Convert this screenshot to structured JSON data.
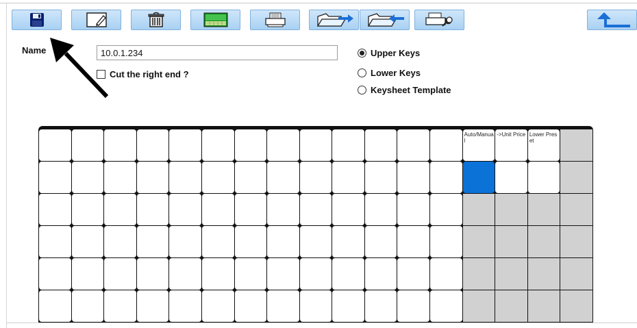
{
  "toolbar": {
    "buttons": [
      {
        "icon": "floppy-disk-icon"
      },
      {
        "icon": "edit-page-icon"
      },
      {
        "icon": "trash-bin-icon"
      },
      {
        "icon": "grid-layout-icon"
      },
      {
        "icon": "printer-icon"
      },
      {
        "icon": "export-folder-icon"
      },
      {
        "icon": "import-folder-icon"
      },
      {
        "icon": "device-settings-icon"
      },
      {
        "icon": "back-up-arrow-icon"
      }
    ]
  },
  "form": {
    "name_label": "Name",
    "name_value": "10.0.1.234",
    "cut_label": "Cut the right end ?",
    "cut_checked": false
  },
  "key_options": {
    "selected": "Upper Keys",
    "options": [
      "Upper Keys",
      "Lower Keys",
      "Keysheet Template"
    ]
  },
  "keyboard": {
    "columns": 17,
    "rows": 6,
    "labels": {
      "r0c13": "Auto/Manual",
      "r0c14": "->Unit Price",
      "r0c15": "Lower Preset"
    },
    "selected_key": "r1c13"
  },
  "colors": {
    "toolbar_bg": "#b8dbf6",
    "selected_key": "#0b72d8",
    "disabled_key": "#d1d1d1"
  }
}
